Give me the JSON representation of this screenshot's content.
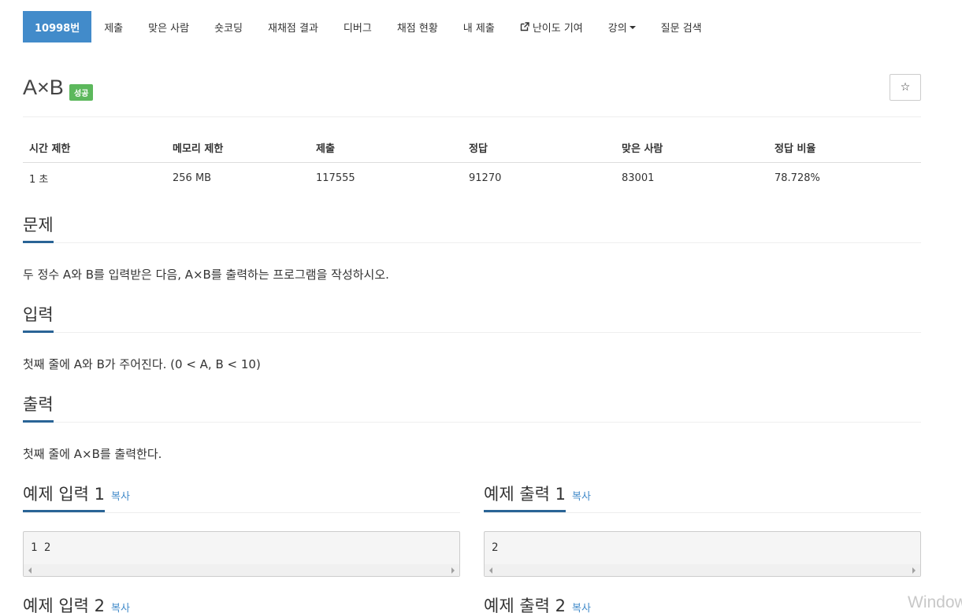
{
  "nav": {
    "items": [
      {
        "label": "10998번"
      },
      {
        "label": "제출"
      },
      {
        "label": "맞은 사람"
      },
      {
        "label": "숏코딩"
      },
      {
        "label": "재채점 결과"
      },
      {
        "label": "디버그"
      },
      {
        "label": "채점 현황"
      },
      {
        "label": "내 제출"
      },
      {
        "label": "난이도 기여",
        "icon": "external-link-icon"
      },
      {
        "label": "강의",
        "icon": "caret-down-icon"
      },
      {
        "label": "질문 검색"
      }
    ]
  },
  "problem": {
    "title": "A×B",
    "badge": "성공",
    "badge_color": "#5cb85c",
    "star": "☆"
  },
  "info": {
    "headers": [
      "시간 제한",
      "메모리 제한",
      "제출",
      "정답",
      "맞은 사람",
      "정답 비율"
    ],
    "values": [
      "1 초",
      "256 MB",
      "117555",
      "91270",
      "83001",
      "78.728%"
    ]
  },
  "sections": {
    "problem_head": "문제",
    "problem_text": "두 정수 A와 B를 입력받은 다음, A×B를 출력하는 프로그램을 작성하시오.",
    "input_head": "입력",
    "input_text": "첫째 줄에 A와 B가 주어진다. (0 < A, B < 10)",
    "output_head": "출력",
    "output_text": "첫째 줄에 A×B를 출력한다."
  },
  "samples": {
    "copy_label": "복사",
    "input1_head": "예제 입력 1",
    "input1_value": "1 2",
    "output1_head": "예제 출력 1",
    "output1_value": "2",
    "input2_head": "예제 입력 2",
    "output2_head": "예제 출력 2"
  },
  "watermark": "Window",
  "colors": {
    "accent": "#428bca",
    "section_underline": "#2a6496",
    "success": "#5cb85c"
  }
}
